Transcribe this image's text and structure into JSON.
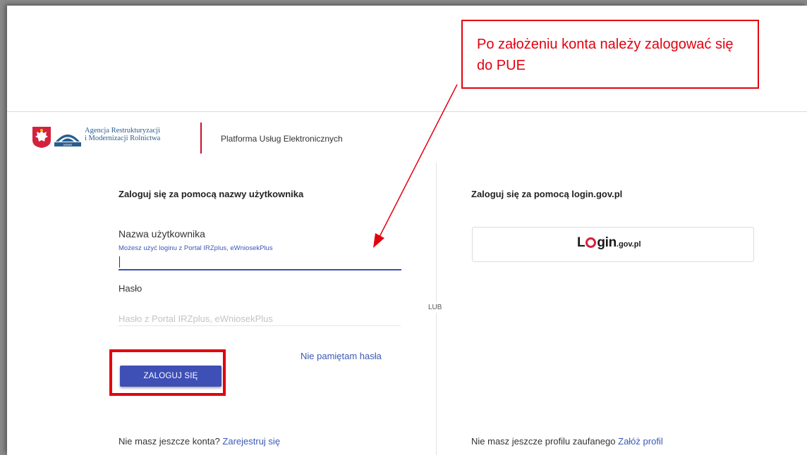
{
  "header": {
    "agency_line1": "Agencja Restrukturyzacji",
    "agency_line2": "i Modernizacji Rolnictwa",
    "logo_caption": "ARiMR",
    "platform": "Platforma Usług Elektronicznych"
  },
  "left_panel": {
    "heading": "Zaloguj się za pomocą nazwy użytkownika",
    "username_label": "Nazwa użytkownika",
    "username_hint": "Możesz użyć loginu z Portal IRZplus, eWniosekPlus",
    "username_value": "",
    "password_label": "Hasło",
    "password_placeholder": "Hasło z Portal IRZplus, eWniosekPlus",
    "forgot_link": "Nie pamiętam hasła",
    "login_button": "ZALOGUJ SIĘ",
    "register_prompt": "Nie masz jeszcze konta?",
    "register_link": "Zarejestruj się"
  },
  "separator": "LUB",
  "right_panel": {
    "heading": "Zaloguj się za pomocą login.gov.pl",
    "logo_part1": "L",
    "logo_part2": "gin",
    "logo_part3": ".gov.pl",
    "profile_prompt": "Nie masz jeszcze profilu zaufanego",
    "profile_link": "Załóż profil"
  },
  "annotation": {
    "callout_text": "Po założeniu konta należy zalogować się do PUE"
  },
  "colors": {
    "primary": "#3e4fb6",
    "link": "#3b59b6",
    "annotation_red": "#e3000f",
    "brand_red": "#c8102e"
  }
}
